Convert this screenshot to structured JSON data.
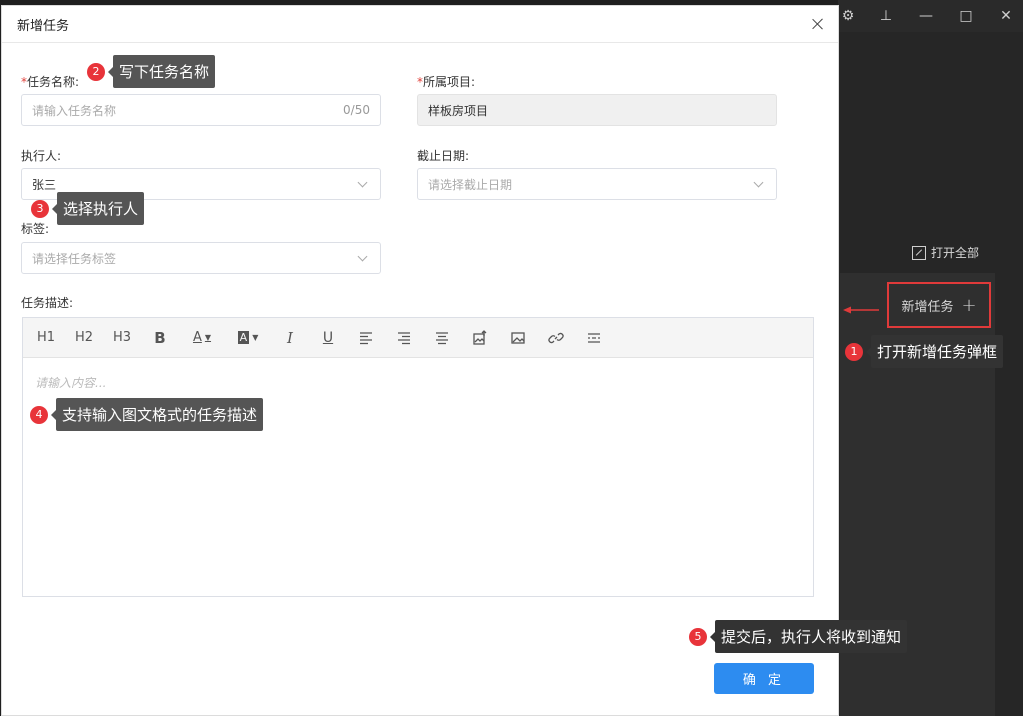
{
  "window_controls": [
    "⚙",
    "⊥",
    "—",
    "□",
    "✕"
  ],
  "side_panel": {
    "open_all": "打开全部",
    "new_task": "新增任务",
    "plus": "+"
  },
  "modal": {
    "title": "新增任务",
    "task_name": {
      "label": "任务名称:",
      "required": "*",
      "placeholder": "请输入任务名称",
      "count": "0/50"
    },
    "project": {
      "label": "所属项目:",
      "required": "*",
      "value": "样板房项目"
    },
    "assignee": {
      "label": "执行人:",
      "value": "张三"
    },
    "deadline": {
      "label": "截止日期:",
      "placeholder": "请选择截止日期"
    },
    "tags": {
      "label": "标签:",
      "placeholder": "请选择任务标签"
    },
    "description": {
      "label": "任务描述:",
      "toolbar": [
        "H1",
        "H2",
        "H3",
        "B",
        "A",
        "A",
        "I",
        "U"
      ],
      "placeholder": "请输入内容..."
    },
    "confirm": "确 定"
  },
  "annotations": [
    {
      "num": "1",
      "text": "打开新增任务弹框"
    },
    {
      "num": "2",
      "text": "写下任务名称"
    },
    {
      "num": "3",
      "text": "选择执行人"
    },
    {
      "num": "4",
      "text": "支持输入图文格式的任务描述"
    },
    {
      "num": "5",
      "text": "提交后，执行人将收到通知"
    }
  ],
  "colors": {
    "accent": "#2d8cf0",
    "annotation_badge": "#e8343a",
    "highlight_border": "#e03a3a"
  }
}
